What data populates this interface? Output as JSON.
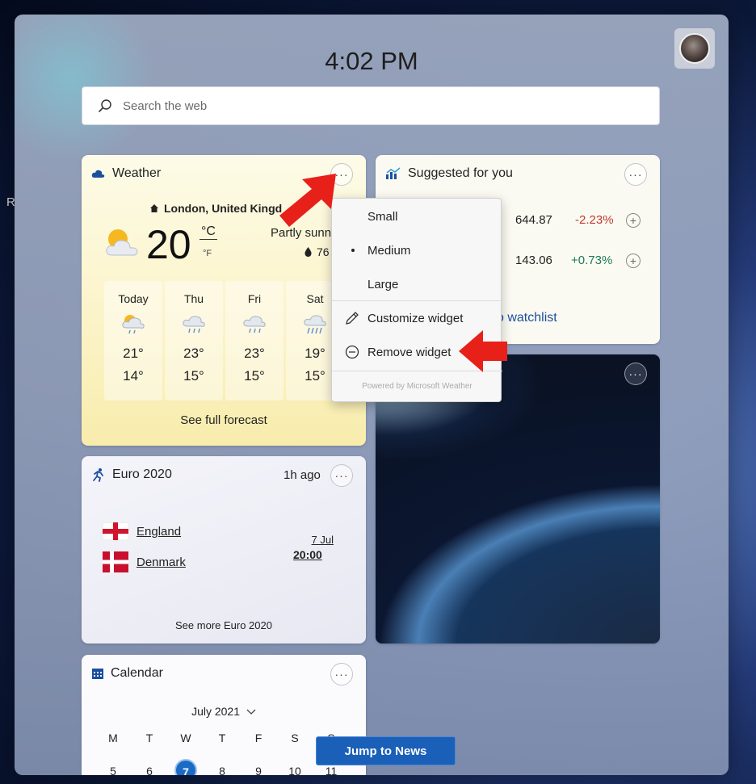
{
  "desktop_letter": "R",
  "header": {
    "time": "4:02 PM"
  },
  "search": {
    "placeholder": "Search the web"
  },
  "weather": {
    "title": "Weather",
    "location": "London, United Kingd",
    "temperature": "20",
    "unit_c": "°C",
    "unit_f": "°F",
    "condition": "Partly sunn",
    "humidity": "76",
    "forecast": [
      {
        "day": "Today",
        "high": "21°",
        "low": "14°",
        "icon": "cloud-sun-rain-icon"
      },
      {
        "day": "Thu",
        "high": "23°",
        "low": "15°",
        "icon": "cloud-rain-icon"
      },
      {
        "day": "Fri",
        "high": "23°",
        "low": "15°",
        "icon": "cloud-rain-icon"
      },
      {
        "day": "Sat",
        "high": "19°",
        "low": "15°",
        "icon": "cloud-heavy-rain-icon"
      }
    ],
    "see_full": "See full forecast"
  },
  "suggested": {
    "title": "Suggested for you",
    "stocks": [
      {
        "value": "644.87",
        "change": "-2.23%",
        "color": "#c0392b"
      },
      {
        "value": "143.06",
        "change": "+0.73%",
        "color": "#1e7a5a"
      }
    ],
    "watchlist_link": "o watchlist"
  },
  "euro": {
    "title": "Euro 2020",
    "time_ago": "1h ago",
    "team1": "England",
    "team2": "Denmark",
    "date": "7 Jul",
    "time": "20:00",
    "see_more": "See more Euro 2020"
  },
  "calendar": {
    "title": "Calendar",
    "month": "July 2021",
    "weekdays": [
      "M",
      "T",
      "W",
      "T",
      "F",
      "S",
      "S"
    ],
    "days": [
      "5",
      "6",
      "7",
      "8",
      "9",
      "10",
      "11"
    ],
    "today": "7"
  },
  "menu": {
    "items": [
      "Small",
      "Medium",
      "Large",
      "Customize widget",
      "Remove widget"
    ],
    "selected": "Medium",
    "powered_by": "Powered by Microsoft Weather"
  },
  "jump_button": "Jump to News",
  "colors": {
    "accent": "#1a5fb8",
    "arrow": "#e8201a",
    "today": "#1b6bc6"
  }
}
